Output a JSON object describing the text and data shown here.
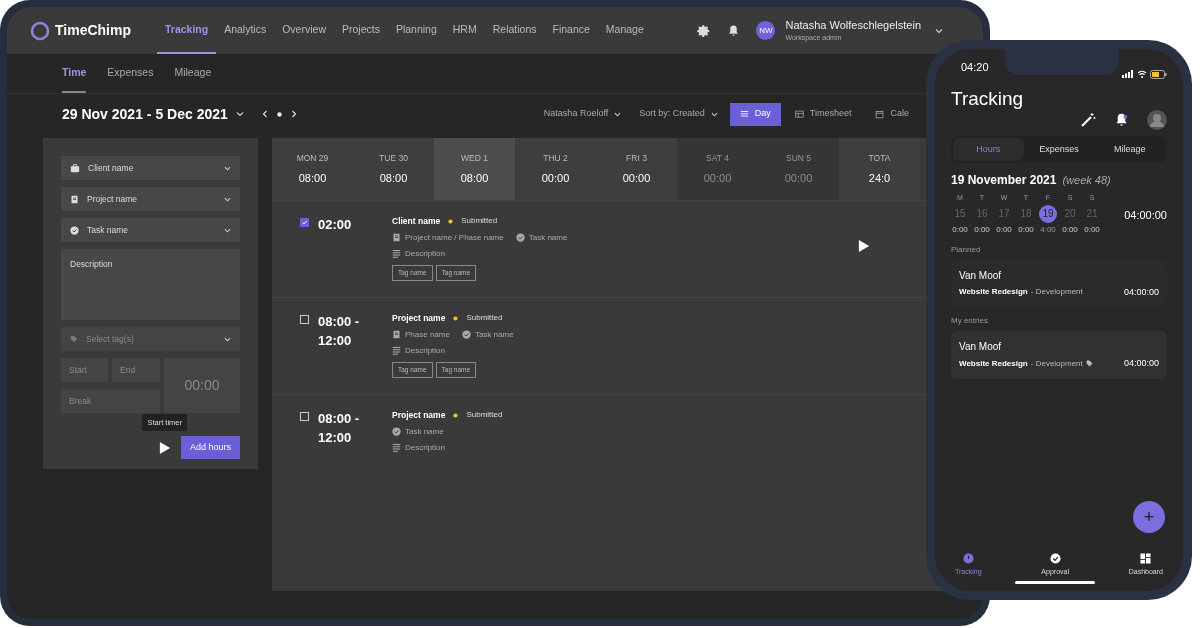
{
  "app": {
    "logo": "TimeChimp",
    "nav": [
      {
        "label": "Tracking",
        "selected": true
      },
      {
        "label": "Analytics",
        "selected": false
      },
      {
        "label": "Overview",
        "selected": false
      },
      {
        "label": "Projects",
        "selected": false
      },
      {
        "label": "Planning",
        "selected": false
      },
      {
        "label": "HRM",
        "selected": false
      },
      {
        "label": "Relations",
        "selected": false
      },
      {
        "label": "Finance",
        "selected": false
      },
      {
        "label": "Manage",
        "selected": false
      }
    ],
    "user": {
      "initials": "NW",
      "name": "Natasha Wolfeschlegelstein",
      "role": "Workspace admin"
    },
    "subtabs": [
      {
        "label": "Time",
        "selected": true
      },
      {
        "label": "Expenses",
        "selected": false
      },
      {
        "label": "Mileage",
        "selected": false
      }
    ],
    "date_range": "29 Nov 2021 - 5 Dec 2021",
    "filters": [
      {
        "label": "Natasha Roeloff"
      },
      {
        "label": "Sort by: Created"
      }
    ],
    "views": [
      {
        "label": "Day",
        "kind": "list",
        "selected": true
      },
      {
        "label": "Timesheet",
        "kind": "table",
        "selected": false
      },
      {
        "label": "Cale",
        "kind": "calendar",
        "selected": false
      }
    ],
    "form": {
      "selects": [
        {
          "placeholder": "Client name",
          "kind": "client"
        },
        {
          "placeholder": "Project name",
          "kind": "project"
        },
        {
          "placeholder": "Task name",
          "kind": "task"
        }
      ],
      "description": {
        "placeholder": "Description"
      },
      "tags": {
        "placeholder": "Select tag(s)",
        "disabled": true
      },
      "start": {
        "placeholder": "Start"
      },
      "end": {
        "placeholder": "End"
      },
      "break": {
        "placeholder": "Break"
      },
      "duration": "00:00",
      "tooltip": "Start timer",
      "submit": "Add hours"
    },
    "week": [
      {
        "day": "MON 29",
        "hours": "08:00",
        "today": false,
        "weekend": false
      },
      {
        "day": "TUE 30",
        "hours": "08:00",
        "today": false,
        "weekend": false
      },
      {
        "day": "WED 1",
        "hours": "08:00",
        "today": true,
        "weekend": false
      },
      {
        "day": "THU 2",
        "hours": "00:00",
        "today": false,
        "weekend": false
      },
      {
        "day": "FRI 3",
        "hours": "00:00",
        "today": false,
        "weekend": false
      },
      {
        "day": "SAT 4",
        "hours": "00:00",
        "today": false,
        "weekend": true
      },
      {
        "day": "SUN 5",
        "hours": "00:00",
        "today": false,
        "weekend": true
      },
      {
        "day": "TOTA",
        "hours": "24:0",
        "today": false,
        "weekend": false
      }
    ],
    "entries": [
      {
        "checked": true,
        "time": "02:00",
        "title": "Client name",
        "status": "Submitted",
        "play": true,
        "meta": [
          [
            {
              "kind": "project",
              "text": "Project name / Phase name"
            },
            {
              "kind": "task",
              "text": "Task name"
            }
          ],
          [
            {
              "kind": "description",
              "text": "Description"
            }
          ]
        ],
        "tags": [
          "Tag name",
          "Tag name"
        ]
      },
      {
        "checked": false,
        "time": "08:00 - 12:00",
        "title": "Project name",
        "status": "Submitted",
        "play": false,
        "meta": [
          [
            {
              "kind": "project",
              "text": "Phase name"
            },
            {
              "kind": "task",
              "text": "Task name"
            }
          ],
          [
            {
              "kind": "description",
              "text": "Description"
            }
          ]
        ],
        "tags": [
          "Tag name",
          "Tag name"
        ]
      },
      {
        "checked": false,
        "time": "08:00 - 12:00",
        "title": "Project name",
        "status": "Submitted",
        "play": false,
        "meta": [
          [
            {
              "kind": "task",
              "text": "Task name"
            }
          ],
          [
            {
              "kind": "description",
              "text": "Description"
            }
          ]
        ]
      }
    ]
  },
  "phone": {
    "clock": "04:20",
    "title": "Tracking",
    "tabs": [
      {
        "label": "Hours",
        "selected": true
      },
      {
        "label": "Expenses",
        "selected": false
      },
      {
        "label": "Mileage",
        "selected": false
      }
    ],
    "date": "19 November 2021",
    "week_label": "(week 48)",
    "total": "04:00:00",
    "days": [
      {
        "letter": "M",
        "date": "15",
        "hours": "0:00",
        "selected": false
      },
      {
        "letter": "T",
        "date": "16",
        "hours": "0:00",
        "selected": false
      },
      {
        "letter": "W",
        "date": "17",
        "hours": "0:00",
        "selected": false
      },
      {
        "letter": "T",
        "date": "18",
        "hours": "0:00",
        "selected": false
      },
      {
        "letter": "F",
        "date": "19",
        "hours": "4:00",
        "selected": true
      },
      {
        "letter": "S",
        "date": "20",
        "hours": "0:00",
        "selected": false
      },
      {
        "letter": "S",
        "date": "21",
        "hours": "0:00",
        "selected": false
      }
    ],
    "sections": [
      {
        "label": "Planned",
        "card": {
          "client": "Van Moof",
          "project": "Website Redesign",
          "task": "- Development",
          "duration": "04:00:00",
          "tag": false
        }
      },
      {
        "label": "My entries",
        "card": {
          "client": "Van Moof",
          "project": "Website Redesign",
          "task": "- Development",
          "duration": "04:00:00",
          "tag": true
        }
      }
    ],
    "fab": "+",
    "bottom_nav": [
      {
        "label": "Tracking",
        "kind": "clock",
        "selected": true
      },
      {
        "label": "Approval",
        "kind": "check",
        "selected": false
      },
      {
        "label": "Dashboard",
        "kind": "grid",
        "selected": false
      }
    ]
  }
}
